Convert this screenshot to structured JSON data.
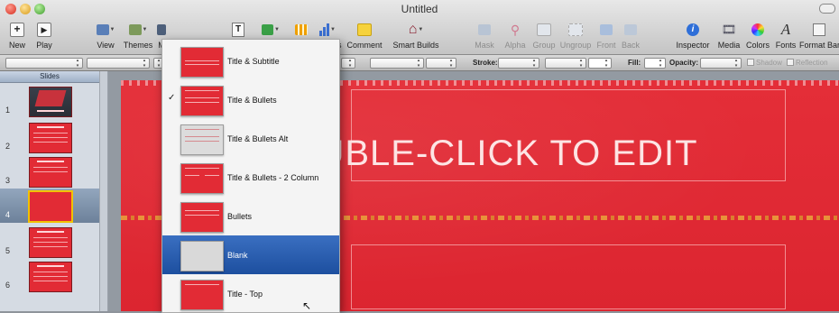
{
  "window": {
    "title": "Untitled"
  },
  "toolbar": {
    "new": "New",
    "play": "Play",
    "view": "View",
    "themes": "Themes",
    "masters": "M",
    "comment": "Comment",
    "smart_builds": "Smart Builds",
    "mask": "Mask",
    "alpha": "Alpha",
    "group": "Group",
    "ungroup": "Ungroup",
    "front": "Front",
    "back": "Back",
    "inspector": "Inspector",
    "media": "Media",
    "colors": "Colors",
    "fonts": "Fonts",
    "format_bar": "Format Bar",
    "s_fragment": "s"
  },
  "format_bar": {
    "stroke_label": "Stroke:",
    "fill_label": "Fill:",
    "opacity_label": "Opacity:",
    "shadow_label": "Shadow",
    "reflection_label": "Reflection"
  },
  "navigator": {
    "header": "Slides",
    "rows": [
      {
        "num": "1"
      },
      {
        "num": "2"
      },
      {
        "num": "3"
      },
      {
        "num": "4"
      },
      {
        "num": "5"
      },
      {
        "num": "6"
      }
    ]
  },
  "slide": {
    "title": "DOUBLE-CLICK TO EDIT"
  },
  "master_menu": {
    "items": [
      {
        "label": "Title & Subtitle",
        "checked": false
      },
      {
        "label": "Title & Bullets",
        "checked": true,
        "check": "✓"
      },
      {
        "label": "Title & Bullets Alt",
        "checked": false
      },
      {
        "label": "Title & Bullets - 2 Column",
        "checked": false
      },
      {
        "label": "Bullets",
        "checked": false
      },
      {
        "label": "Blank",
        "checked": false
      },
      {
        "label": "Title - Top",
        "checked": false
      }
    ]
  },
  "colors": {
    "slide_red": "#e22b35",
    "menu_highlight": "#1d4f9f"
  }
}
